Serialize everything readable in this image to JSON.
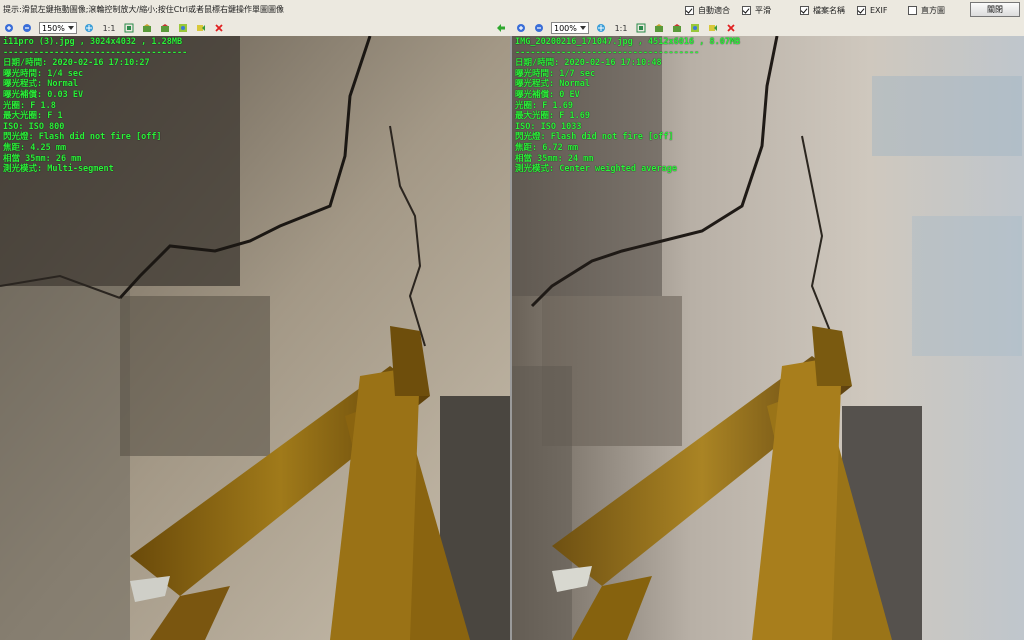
{
  "hint": "提示:滑鼠左鍵拖動圖像;滾輪控制放大/縮小;按住Ctrl或者鼠標右鍵操作單圖圖像",
  "options": [
    {
      "label": "自動適合",
      "checked": true
    },
    {
      "label": "平滑",
      "checked": true
    },
    {
      "label": "檔案名稱",
      "checked": true
    },
    {
      "label": "EXIF",
      "checked": true
    },
    {
      "label": "直方圖",
      "checked": false
    }
  ],
  "close_label": "關閉",
  "left": {
    "zoom": "150%",
    "actual_size": "1:1",
    "header": "i11pro (3).jpg , 3024x4032 , 1.28MB",
    "separator": "------------------------------------",
    "exif": [
      "日期/時間: 2020-02-16 17:10:27",
      "曝光時間: 1/4 sec",
      "曝光程式: Normal",
      "曝光補償: 0.03 EV",
      "光圈: F 1.8",
      "最大光圈: F 1",
      "ISO: ISO 800",
      "閃光燈: Flash did not fire [off]",
      "焦距: 4.25 mm",
      "相當 35mm: 26 mm",
      "測光模式: Multi-segment"
    ]
  },
  "right": {
    "zoom": "100%",
    "actual_size": "1:1",
    "header": "IMG_20200216_171047.jpg , 4512x6016 , 8.07MB",
    "separator": "------------------------------------",
    "exif": [
      "日期/時間: 2020-02-16 17:10:48",
      "曝光時間: 1/7 sec",
      "曝光程式: Normal",
      "曝光補償: 0 EV",
      "光圈: F 1.69",
      "最大光圈: F 1.69",
      "ISO: ISO 1033",
      "閃光燈: Flash did not fire [off]",
      "焦距: 6.72 mm",
      "相當 35mm: 24 mm",
      "測光模式: Center weighted average"
    ]
  },
  "colors": {
    "exif_text": "#2cf13a",
    "wood_left": "#8a6410",
    "wood_right": "#9a7418"
  }
}
